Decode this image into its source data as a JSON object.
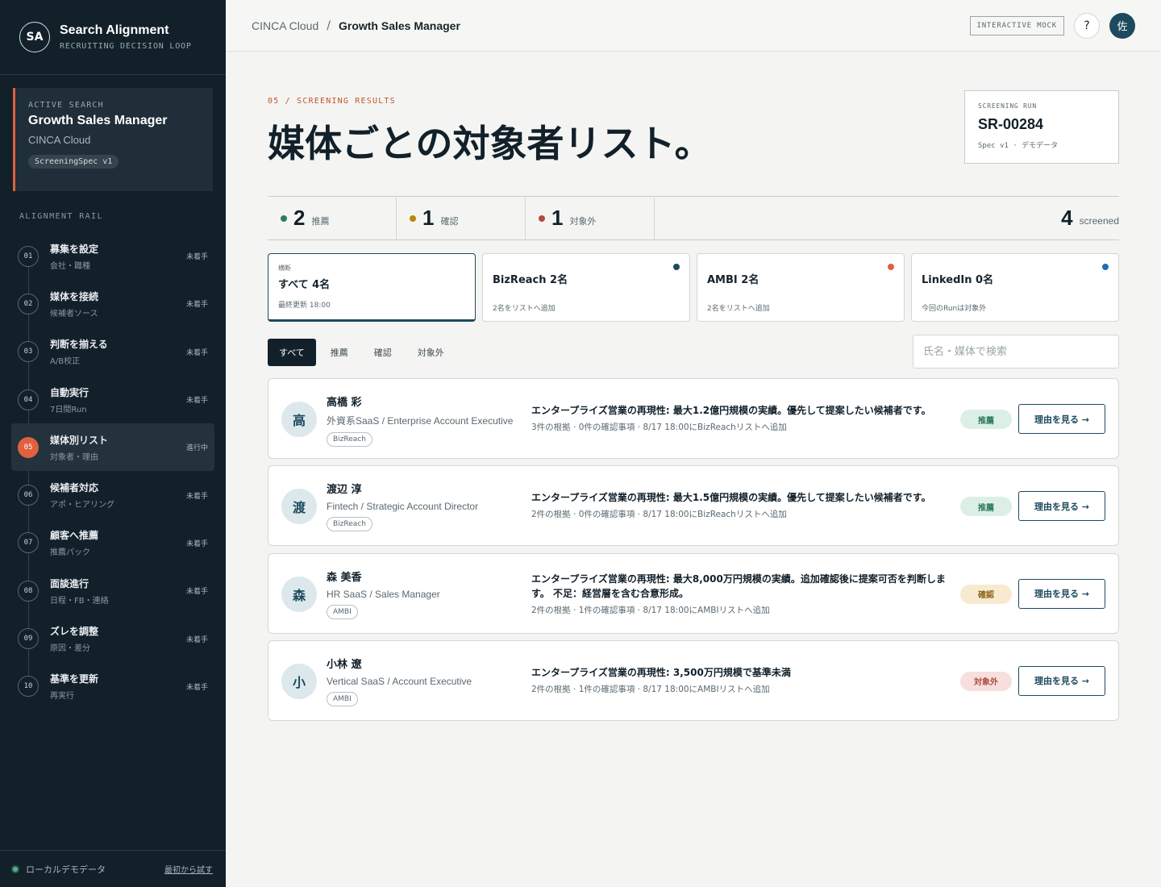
{
  "brand": {
    "logo": "SA",
    "title": "Search Alignment",
    "subtitle": "RECRUITING DECISION LOOP"
  },
  "active_search": {
    "label": "ACTIVE SEARCH",
    "title": "Growth Sales Manager",
    "company": "CINCA Cloud",
    "spec": "ScreeningSpec v1"
  },
  "rail": {
    "label": "ALIGNMENT RAIL",
    "items": [
      {
        "num": "01",
        "title": "募集を設定",
        "sub": "会社・職種",
        "status": "未着手"
      },
      {
        "num": "02",
        "title": "媒体を接続",
        "sub": "候補者ソース",
        "status": "未着手"
      },
      {
        "num": "03",
        "title": "判断を揃える",
        "sub": "A/B校正",
        "status": "未着手"
      },
      {
        "num": "04",
        "title": "自動実行",
        "sub": "7日間Run",
        "status": "未着手"
      },
      {
        "num": "05",
        "title": "媒体別リスト",
        "sub": "対象者・理由",
        "status": "進行中"
      },
      {
        "num": "06",
        "title": "候補者対応",
        "sub": "アポ・ヒアリング",
        "status": "未着手"
      },
      {
        "num": "07",
        "title": "顧客へ推薦",
        "sub": "推薦パック",
        "status": "未着手"
      },
      {
        "num": "08",
        "title": "面談進行",
        "sub": "日程・FB・連絡",
        "status": "未着手"
      },
      {
        "num": "09",
        "title": "ズレを調整",
        "sub": "原因・差分",
        "status": "未着手"
      },
      {
        "num": "10",
        "title": "基準を更新",
        "sub": "再実行",
        "status": "未着手"
      }
    ]
  },
  "footer": {
    "text": "ローカルデモデータ",
    "link": "最初から試す"
  },
  "topbar": {
    "crumb_root": "CINCA Cloud",
    "crumb_sep": "/",
    "crumb_current": "Growth Sales Manager",
    "mock_badge": "INTERACTIVE MOCK",
    "help": "?",
    "avatar": "佐"
  },
  "header": {
    "eyebrow": "05 / SCREENING RESULTS",
    "title": "媒体ごとの対象者リスト。"
  },
  "run": {
    "label": "SCREENING RUN",
    "id": "SR-00284",
    "sub": "Spec v1 · デモデータ"
  },
  "stats": {
    "items": [
      {
        "num": "2",
        "label": "推薦",
        "color": "#2f7d5c"
      },
      {
        "num": "1",
        "label": "確認",
        "color": "#b8860b"
      },
      {
        "num": "1",
        "label": "対象外",
        "color": "#b04a3e"
      }
    ],
    "total": {
      "num": "4",
      "label": "screened"
    }
  },
  "media": {
    "all": {
      "over": "横断",
      "title": "すべて 4名",
      "sub": "最終更新 18:00"
    },
    "cards": [
      {
        "title": "BizReach 2名",
        "sub": "2名をリストへ追加",
        "color": "#1d4a5e"
      },
      {
        "title": "AMBI 2名",
        "sub": "2名をリストへ追加",
        "color": "#e0603f"
      },
      {
        "title": "LinkedIn 0名",
        "sub": "今回のRunは対象外",
        "color": "#1d6fb8"
      }
    ]
  },
  "filters": {
    "tabs": [
      "すべて",
      "推薦",
      "確認",
      "対象外"
    ],
    "search_placeholder": "氏名・媒体で検索"
  },
  "candidates": [
    {
      "initial": "高",
      "name": "高橋 彩",
      "role": "外資系SaaS / Enterprise Account Executive",
      "media": "BizReach",
      "summary": "エンタープライズ営業の再現性: 最大1.2億円規模の実績。優先して提案したい候補者です。",
      "meta": "3件の根拠 · 0件の確認事項 · 8/17 18:00にBizReachリストへ追加",
      "verdict": "推薦",
      "action": "理由を見る →"
    },
    {
      "initial": "渡",
      "name": "渡辺 淳",
      "role": "Fintech / Strategic Account Director",
      "media": "BizReach",
      "summary": "エンタープライズ営業の再現性: 最大1.5億円規模の実績。優先して提案したい候補者です。",
      "meta": "2件の根拠 · 0件の確認事項 · 8/17 18:00にBizReachリストへ追加",
      "verdict": "推薦",
      "action": "理由を見る →"
    },
    {
      "initial": "森",
      "name": "森 美香",
      "role": "HR SaaS / Sales Manager",
      "media": "AMBI",
      "summary": "エンタープライズ営業の再現性: 最大8,000万円規模の実績。追加確認後に提案可否を判断します。 不足：経営層を含む合意形成。",
      "meta": "2件の根拠 · 1件の確認事項 · 8/17 18:00にAMBIリストへ追加",
      "verdict": "確認",
      "action": "理由を見る →"
    },
    {
      "initial": "小",
      "name": "小林 遼",
      "role": "Vertical SaaS / Account Executive",
      "media": "AMBI",
      "summary": "エンタープライズ営業の再現性: 3,500万円規模で基準未満",
      "meta": "2件の根拠 · 1件の確認事項 · 8/17 18:00にAMBIリストへ追加",
      "verdict": "対象外",
      "action": "理由を見る →"
    }
  ]
}
